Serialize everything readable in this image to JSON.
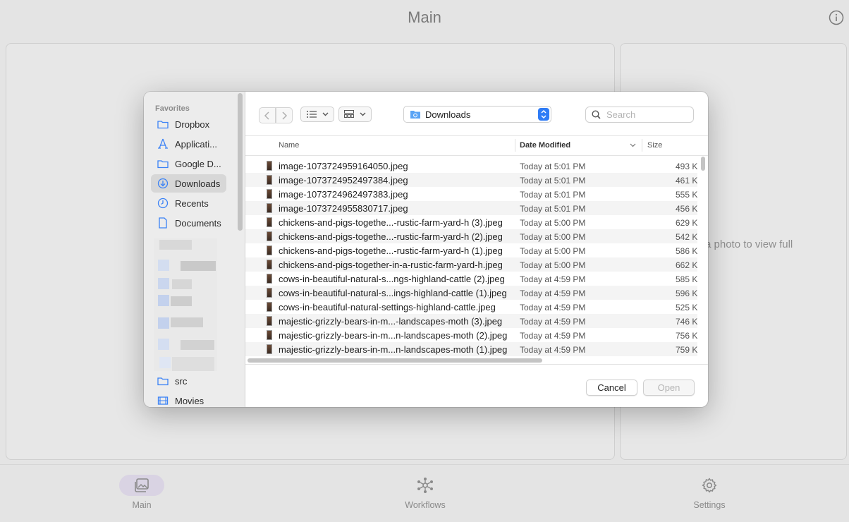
{
  "app": {
    "title": "Main",
    "preview_hint": "a photo to view full"
  },
  "tabs": [
    {
      "label": "Main",
      "icon": "photo-stack-icon",
      "active": true
    },
    {
      "label": "Workflows",
      "icon": "network-icon",
      "active": false
    },
    {
      "label": "Settings",
      "icon": "gear-icon",
      "active": false
    }
  ],
  "dialog": {
    "sidebar": {
      "heading": "Favorites",
      "items": [
        {
          "label": "Dropbox",
          "icon": "folder-icon"
        },
        {
          "label": "Applicati...",
          "icon": "applications-icon"
        },
        {
          "label": "Google D...",
          "icon": "folder-icon"
        },
        {
          "label": "Downloads",
          "icon": "download-icon",
          "selected": true
        },
        {
          "label": "Recents",
          "icon": "clock-icon"
        },
        {
          "label": "Documents",
          "icon": "document-icon"
        }
      ],
      "bottom_items": [
        {
          "label": "src",
          "icon": "folder-icon"
        },
        {
          "label": "Movies",
          "icon": "film-icon"
        }
      ]
    },
    "location": {
      "label": "Downloads"
    },
    "search": {
      "placeholder": "Search"
    },
    "columns": {
      "name": "Name",
      "date": "Date Modified",
      "size": "Size"
    },
    "files": [
      {
        "name": "image-1073724959164050.jpeg",
        "date": "Today at 5:01 PM",
        "size": "493 K"
      },
      {
        "name": "image-1073724952497384.jpeg",
        "date": "Today at 5:01 PM",
        "size": "461 K"
      },
      {
        "name": "image-1073724962497383.jpeg",
        "date": "Today at 5:01 PM",
        "size": "555 K"
      },
      {
        "name": "image-1073724955830717.jpeg",
        "date": "Today at 5:01 PM",
        "size": "456 K"
      },
      {
        "name": "chickens-and-pigs-togethe...-rustic-farm-yard-h (3).jpeg",
        "date": "Today at 5:00 PM",
        "size": "629 K"
      },
      {
        "name": "chickens-and-pigs-togethe...-rustic-farm-yard-h (2).jpeg",
        "date": "Today at 5:00 PM",
        "size": "542 K"
      },
      {
        "name": "chickens-and-pigs-togethe...-rustic-farm-yard-h (1).jpeg",
        "date": "Today at 5:00 PM",
        "size": "586 K"
      },
      {
        "name": "chickens-and-pigs-together-in-a-rustic-farm-yard-h.jpeg",
        "date": "Today at 5:00 PM",
        "size": "662 K"
      },
      {
        "name": "cows-in-beautiful-natural-s...ngs-highland-cattle (2).jpeg",
        "date": "Today at 4:59 PM",
        "size": "585 K"
      },
      {
        "name": "cows-in-beautiful-natural-s...ings-highland-cattle (1).jpeg",
        "date": "Today at 4:59 PM",
        "size": "596 K"
      },
      {
        "name": "cows-in-beautiful-natural-settings-highland-cattle.jpeg",
        "date": "Today at 4:59 PM",
        "size": "525 K"
      },
      {
        "name": "majestic-grizzly-bears-in-m...-landscapes-moth (3).jpeg",
        "date": "Today at 4:59 PM",
        "size": "746 K"
      },
      {
        "name": "majestic-grizzly-bears-in-m...n-landscapes-moth (2).jpeg",
        "date": "Today at 4:59 PM",
        "size": "756 K"
      },
      {
        "name": "majestic-grizzly-bears-in-m...n-landscapes-moth (1).jpeg",
        "date": "Today at 4:59 PM",
        "size": "759 K"
      }
    ],
    "buttons": {
      "cancel": "Cancel",
      "open": "Open"
    }
  },
  "colors": {
    "accent": "#2f7cf6",
    "tab_active_bg": "#d9d3e3",
    "sidebar_icon": "#3b82f6"
  }
}
